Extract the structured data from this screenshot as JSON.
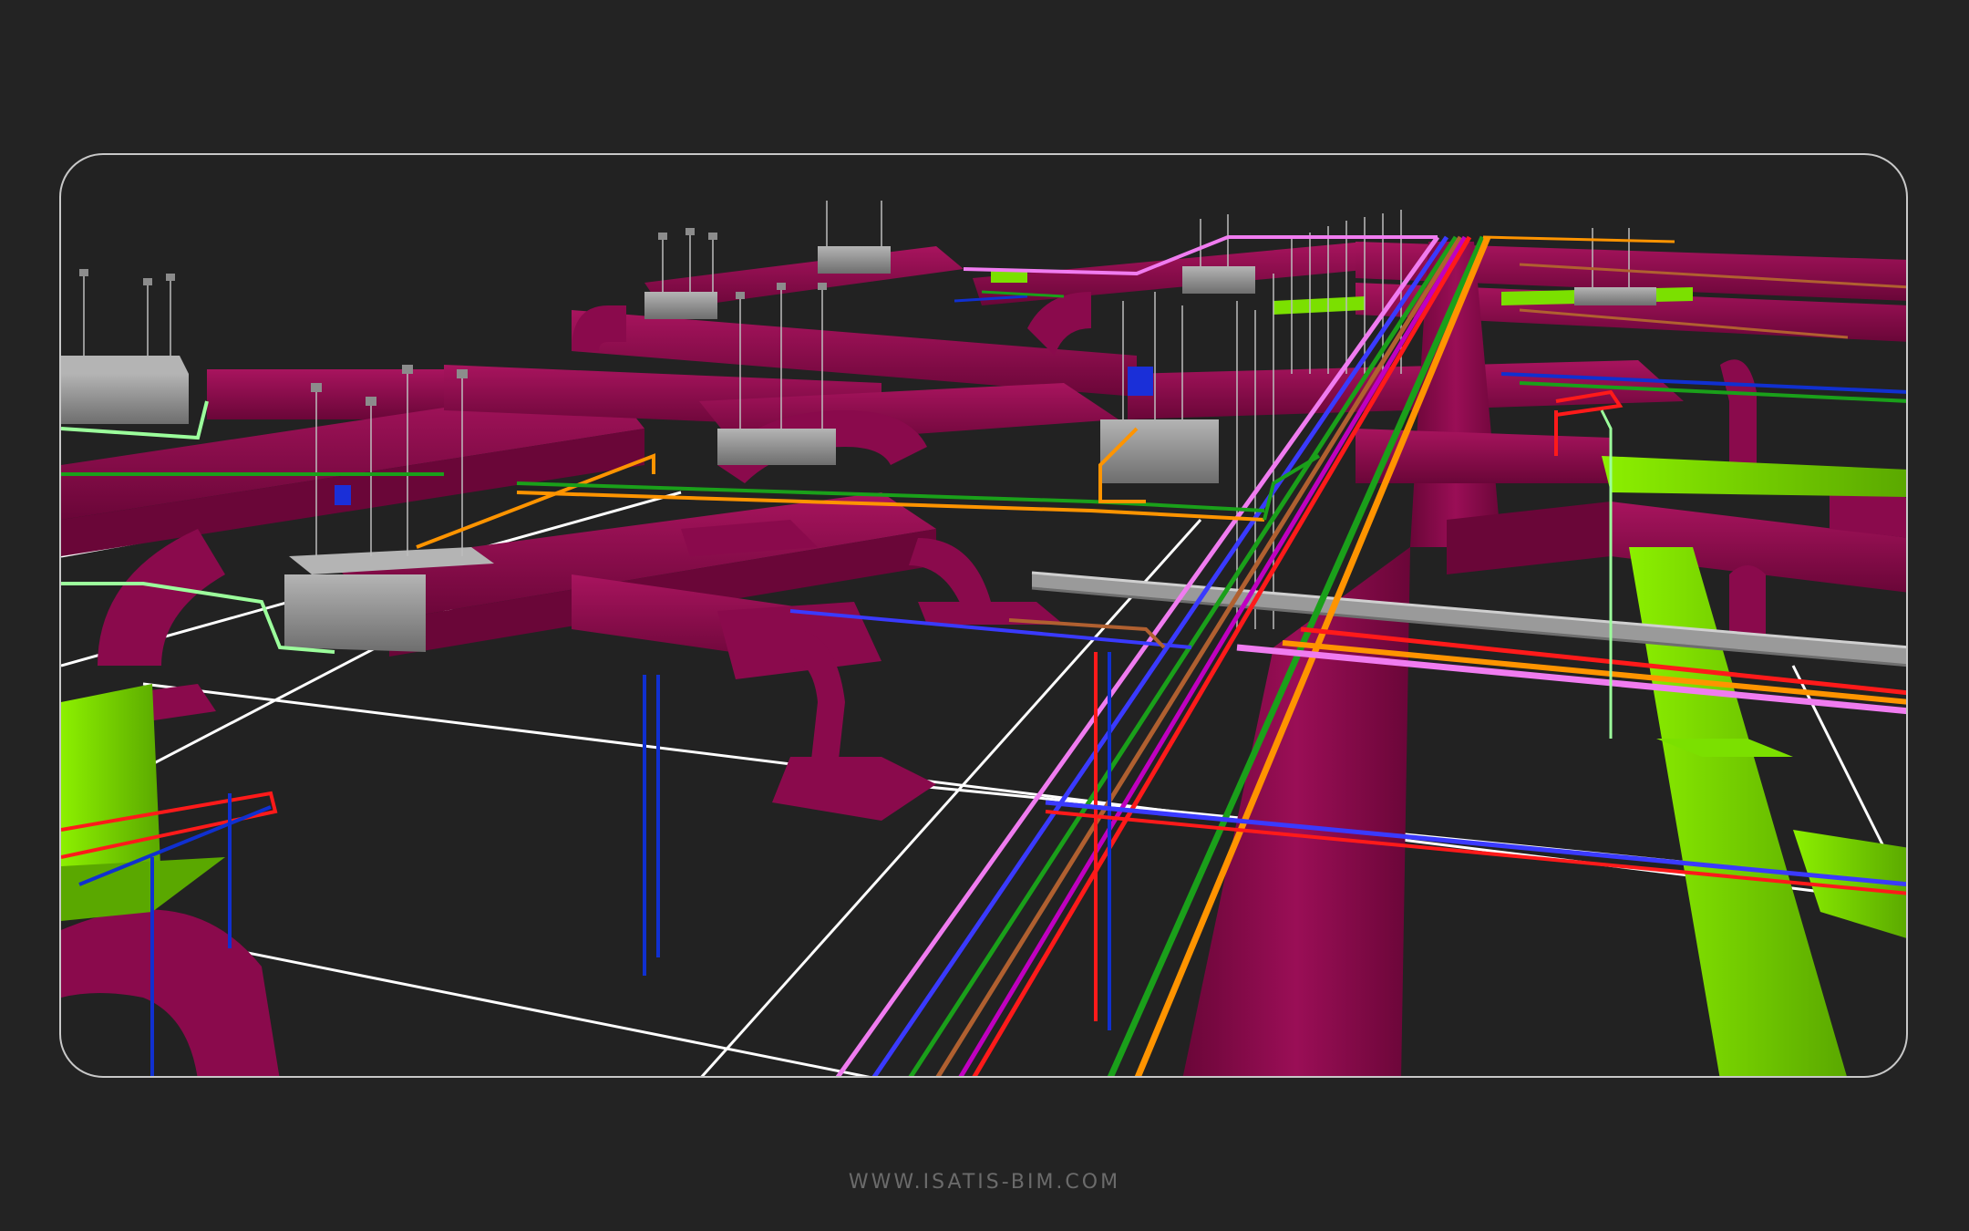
{
  "scene": {
    "subject": "mep-3d-model",
    "palette": {
      "background": "#232323",
      "frame_border": "#c8c8c8",
      "duct": "#8a0a4c",
      "duct_dark": "#6a0638",
      "duct_light": "#a8145e",
      "green_duct": "#7be000",
      "green_duct_dark": "#5aa800",
      "air_unit": "#8c8c8c",
      "floor_grid": "#ffffff",
      "pipe_pink": "#f07cf0",
      "pipe_magenta": "#c000c0",
      "pipe_blue": "#3a3aff",
      "pipe_green": "#1aa01a",
      "pipe_orange": "#ff9400",
      "pipe_red": "#ff1a1a",
      "pipe_brown": "#b06030",
      "pipe_lightgreen": "#9cff9c",
      "cable_tray": "#9a9a9a"
    }
  },
  "footer": {
    "url": "WWW.ISATIS-BIM.COM"
  }
}
